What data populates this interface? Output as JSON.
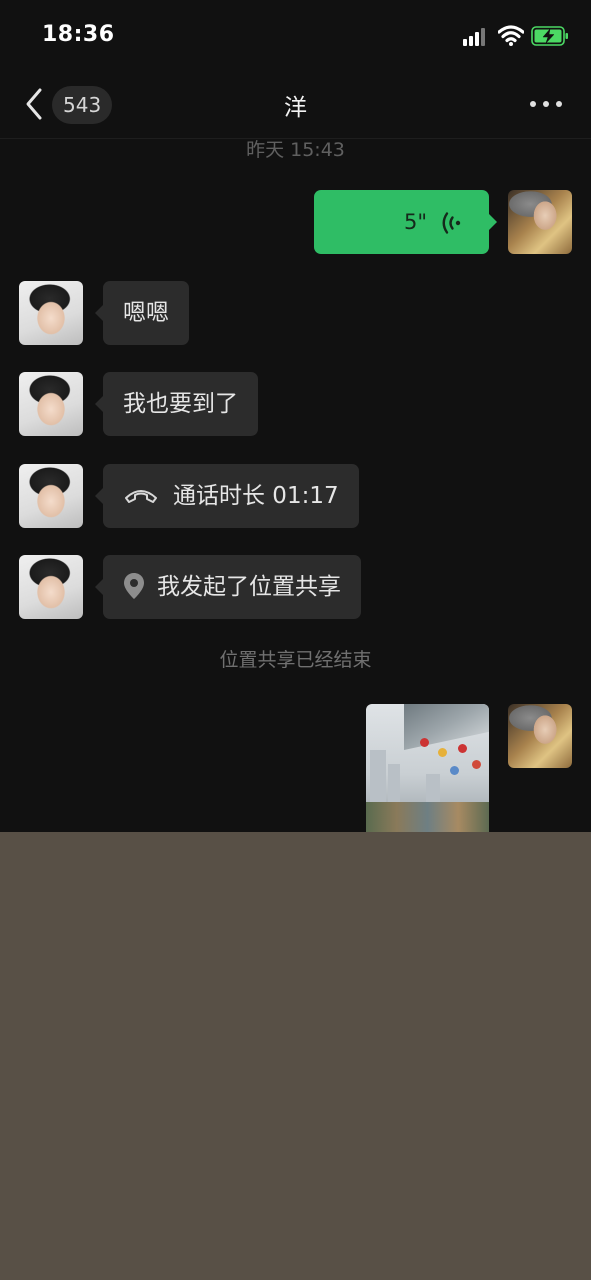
{
  "status_bar": {
    "time": "18:36",
    "signal_icon": "cellular-signal-icon",
    "wifi_icon": "wifi-icon",
    "battery_icon": "battery-charging-icon",
    "battery_color": "#4cd964"
  },
  "nav": {
    "back_icon": "chevron-left-icon",
    "unread_count": "543",
    "title": "洋",
    "more_icon": "more-dots-icon"
  },
  "chat": {
    "timestamp": "昨天 15:43",
    "messages": [
      {
        "from": "me",
        "type": "voice",
        "duration": "5\"",
        "icon": "voice-wave-icon"
      },
      {
        "from": "other",
        "type": "text",
        "text": "嗯嗯"
      },
      {
        "from": "other",
        "type": "text",
        "text": "我也要到了"
      },
      {
        "from": "other",
        "type": "call",
        "text": "通话时长 01:17",
        "icon": "phone-hangup-icon"
      },
      {
        "from": "other",
        "type": "location-share",
        "text": "我发起了位置共享",
        "icon": "location-pin-icon"
      },
      {
        "from": "system",
        "type": "system",
        "text": "位置共享已经结束"
      },
      {
        "from": "me",
        "type": "image"
      }
    ]
  },
  "colors": {
    "background": "#111111",
    "incoming_bubble": "#2c2c2c",
    "outgoing_bubble": "#2fbd65",
    "muted_text": "#606060",
    "bottom_area": "#585046"
  }
}
